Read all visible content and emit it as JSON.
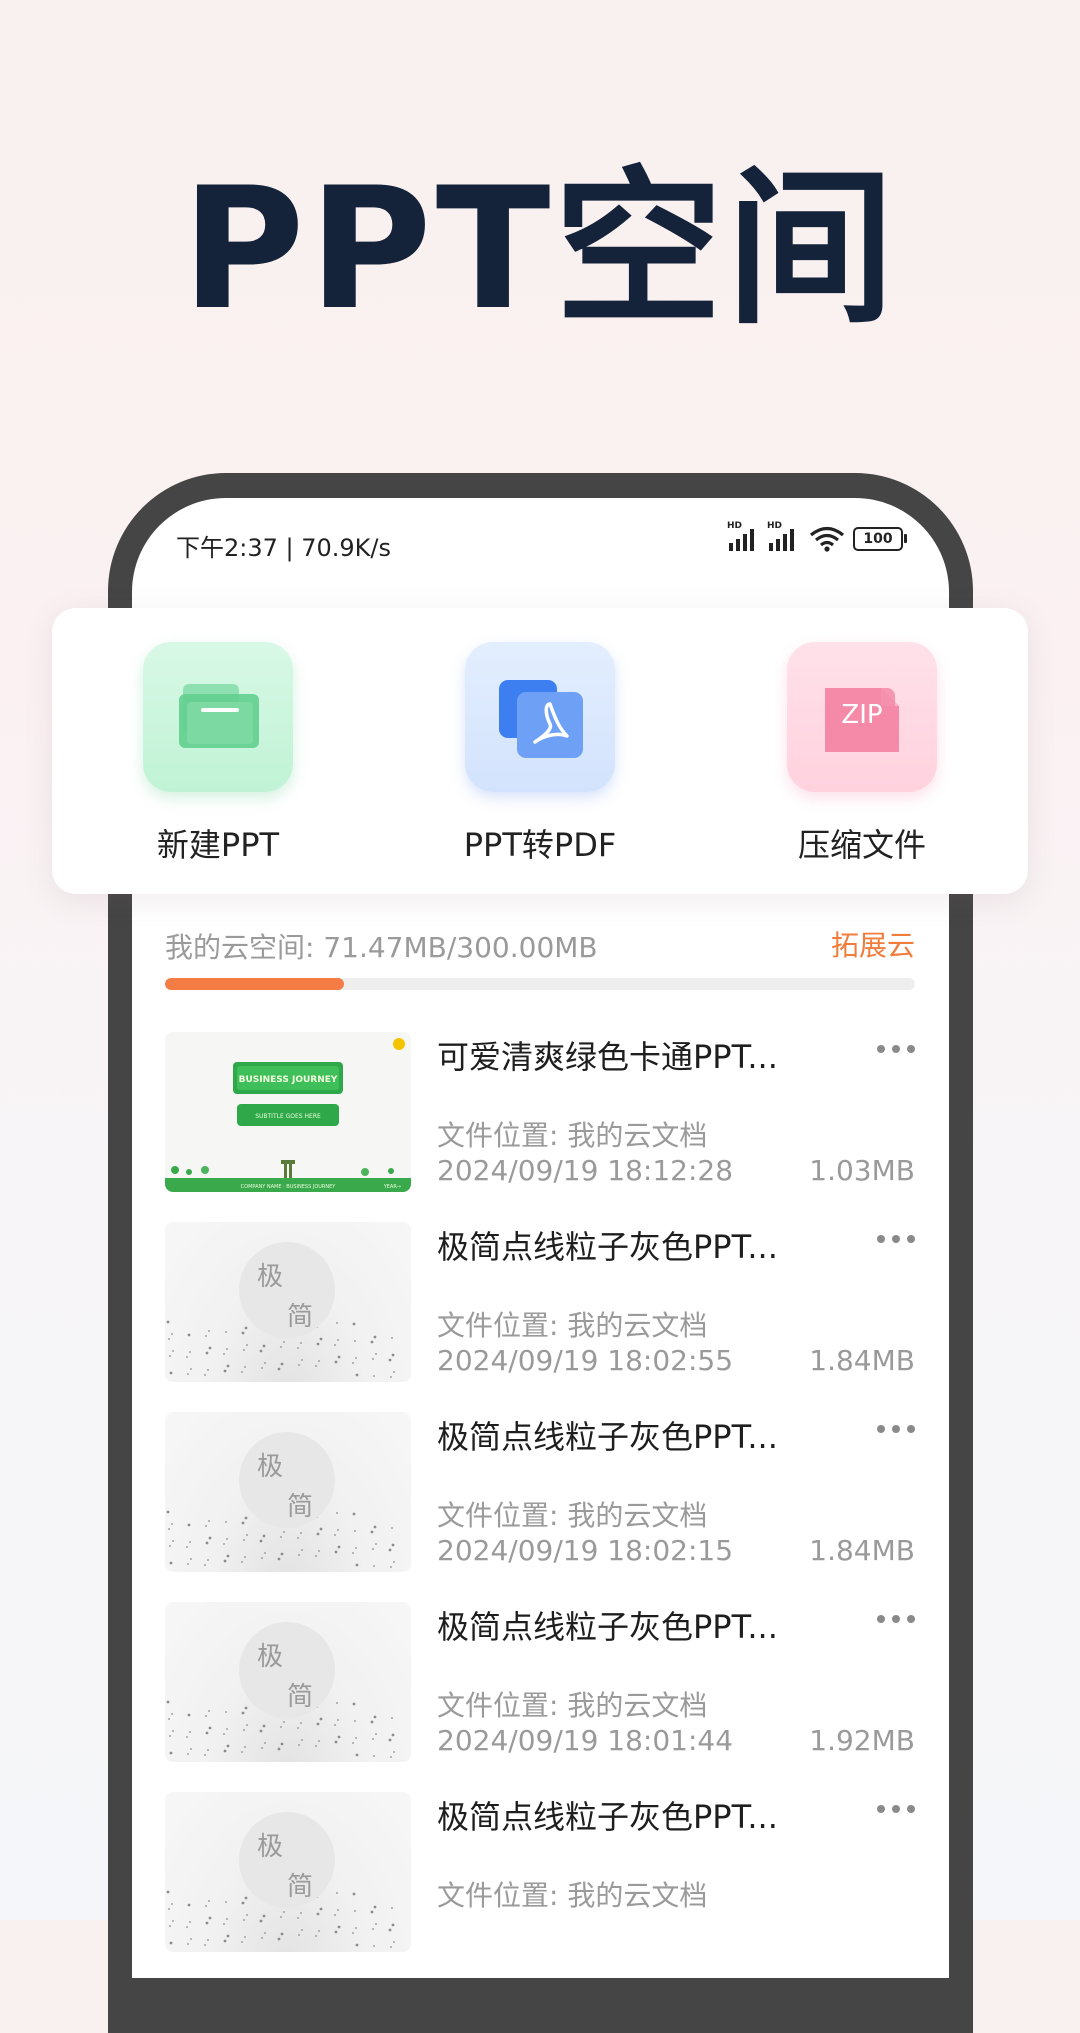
{
  "hero": {
    "title": "PPT空间"
  },
  "status_bar": {
    "time_speed": "下午2:37 | 70.9K/s",
    "hd_label": "HD",
    "battery": "100"
  },
  "actions": [
    {
      "label": "新建PPT",
      "icon": "folder-icon",
      "color": "#7fdca6"
    },
    {
      "label": "PPT转PDF",
      "icon": "pdf-convert-icon",
      "color": "#4f8ef5"
    },
    {
      "label": "压缩文件",
      "icon": "zip-icon",
      "color": "#f58aa8",
      "icon_text": "ZIP"
    }
  ],
  "storage": {
    "label": "我的云空间: 71.47MB/300.00MB",
    "expand_label": "拓展云",
    "used_fraction": 0.238,
    "accent": "#f57d45"
  },
  "files": [
    {
      "name": "可爱清爽绿色卡通PPT...",
      "location": "文件位置: 我的云文档",
      "date": "2024/09/19 18:12:28",
      "size": "1.03MB",
      "thumb": {
        "kind": "green-cartoon",
        "headline": "BUSINESS JOURNEY",
        "subline": "SUBTITLE GOES HERE",
        "footer": "COMPANY NAME · BUSINESS JOURNEY",
        "page": "YEAR→"
      }
    },
    {
      "name": "极简点线粒子灰色PPT...",
      "location": "文件位置: 我的云文档",
      "date": "2024/09/19 18:02:55",
      "size": "1.84MB",
      "thumb": {
        "kind": "minimal-gray",
        "char1": "极",
        "char2": "简"
      }
    },
    {
      "name": "极简点线粒子灰色PPT...",
      "location": "文件位置: 我的云文档",
      "date": "2024/09/19 18:02:15",
      "size": "1.84MB",
      "thumb": {
        "kind": "minimal-gray",
        "char1": "极",
        "char2": "简"
      }
    },
    {
      "name": "极简点线粒子灰色PPT...",
      "location": "文件位置: 我的云文档",
      "date": "2024/09/19 18:01:44",
      "size": "1.92MB",
      "thumb": {
        "kind": "minimal-gray",
        "char1": "极",
        "char2": "简"
      }
    },
    {
      "name": "极简点线粒子灰色PPT...",
      "location": "文件位置: 我的云文档",
      "date": "",
      "size": "",
      "thumb": {
        "kind": "minimal-gray",
        "char1": "极",
        "char2": "简"
      }
    }
  ]
}
